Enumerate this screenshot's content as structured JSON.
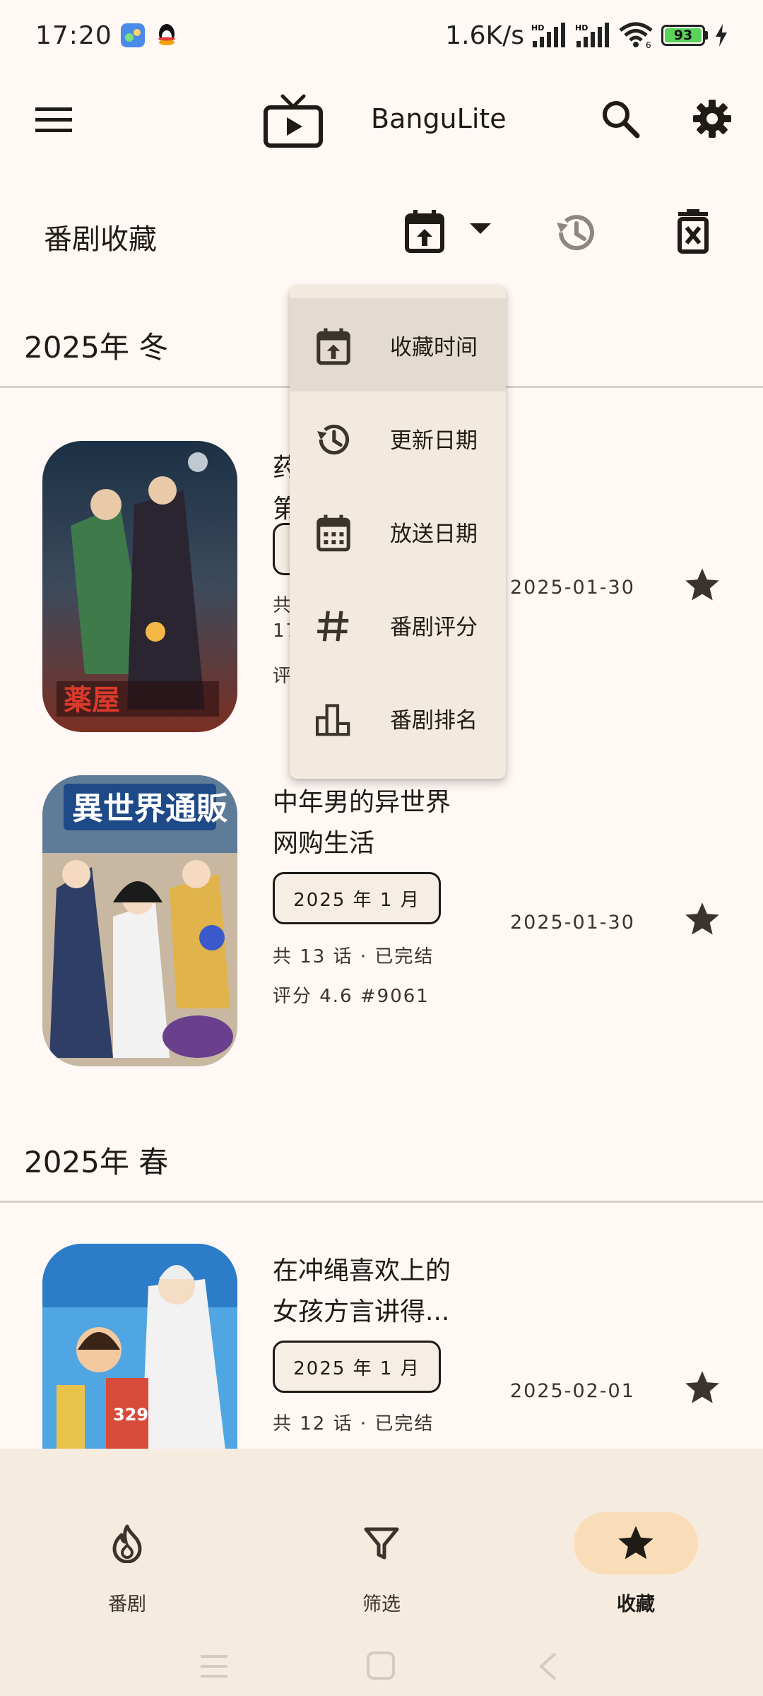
{
  "status_bar": {
    "time": "17:20",
    "network_speed": "1.6K/s",
    "battery": "93"
  },
  "app_bar": {
    "title": "BanguLite",
    "menu_icon": "hamburger-menu-icon",
    "logo_icon": "tv-play-icon",
    "search_icon": "search-icon",
    "settings_icon": "gear-icon"
  },
  "toolbar": {
    "title": "番剧收藏",
    "sort_icon": "calendar-upload-icon",
    "history_icon": "history-icon",
    "delete_icon": "delete-icon"
  },
  "sort_menu": {
    "items": [
      {
        "label": "收藏时间",
        "icon": "calendar-upload-icon",
        "selected": true
      },
      {
        "label": "更新日期",
        "icon": "history-icon",
        "selected": false
      },
      {
        "label": "放送日期",
        "icon": "calendar-icon",
        "selected": false
      },
      {
        "label": "番剧评分",
        "icon": "hash-icon",
        "selected": false
      },
      {
        "label": "番剧排名",
        "icon": "bar-chart-icon",
        "selected": false
      }
    ]
  },
  "seasons": [
    {
      "label": "2025年 冬",
      "items": [
        {
          "title_line1": "药",
          "title_line2": "第",
          "chip": "",
          "episodes": "共",
          "rating": "评",
          "extra": "17",
          "date": "2025-01-30"
        },
        {
          "title_line1": "中年男的异世界",
          "title_line2": "网购生活",
          "chip": "2025 年 1 月",
          "episodes": "共 13 话 · 已完结",
          "rating": "评分 4.6 #9061",
          "date": "2025-01-30"
        }
      ]
    },
    {
      "label": "2025年 春",
      "items": [
        {
          "title_line1": "在冲绳喜欢上的",
          "title_line2": "女孩方言讲得...",
          "chip": "2025 年 1 月",
          "episodes": "共 12 话 · 已完结",
          "date": "2025-02-01"
        }
      ]
    }
  ],
  "bottom_nav": {
    "items": [
      {
        "label": "番剧",
        "icon": "flame-icon",
        "active": false
      },
      {
        "label": "筛选",
        "icon": "filter-icon",
        "active": false
      },
      {
        "label": "收藏",
        "icon": "star-icon",
        "active": true
      }
    ]
  },
  "colors": {
    "background": "#FFF8F4",
    "menu": "#F3EADF",
    "nav_active": "#F9DDB8",
    "text": "#1F1B16"
  }
}
